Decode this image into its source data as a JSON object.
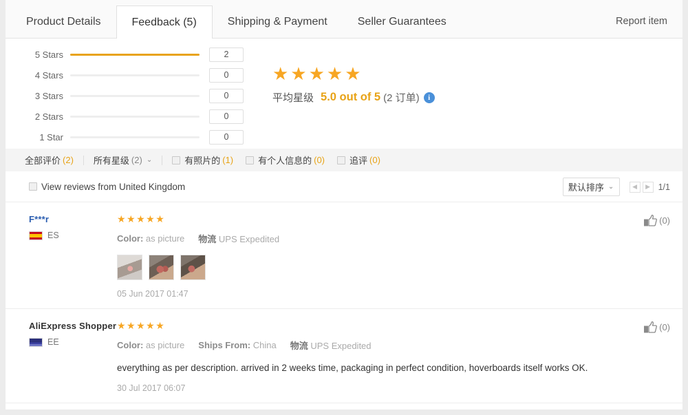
{
  "tabs": [
    {
      "label": "Product Details",
      "active": false
    },
    {
      "label": "Feedback (5)",
      "active": true
    },
    {
      "label": "Shipping & Payment",
      "active": false
    },
    {
      "label": "Seller Guarantees",
      "active": false
    }
  ],
  "report_item": "Report item",
  "rating_breakdown": [
    {
      "label": "5 Stars",
      "count": "2",
      "percent": 100
    },
    {
      "label": "4 Stars",
      "count": "0",
      "percent": 0
    },
    {
      "label": "3 Stars",
      "count": "0",
      "percent": 0
    },
    {
      "label": "2 Stars",
      "count": "0",
      "percent": 0
    },
    {
      "label": "1 Star",
      "count": "0",
      "percent": 0
    }
  ],
  "average": {
    "stars_filled": 5,
    "label": "平均星级",
    "score": "5.0 out of 5",
    "orders": "(2 订单)",
    "info_icon": "info-icon",
    "info_glyph": "i"
  },
  "filters": {
    "all_reviews": "全部评价",
    "all_reviews_count": "(2)",
    "all_stars": "所有星级",
    "all_stars_count": "(2)",
    "caret": "⌄",
    "with_photos": "有照片的",
    "with_photos_count": "(1)",
    "with_personal_info": "有个人信息的",
    "with_personal_info_count": "(0)",
    "additional": "追评",
    "additional_count": "(0)"
  },
  "sort_row": {
    "view_reviews_label": "View reviews from United Kingdom",
    "sort_label": "默认排序",
    "sort_caret": "⌄",
    "prev_arrow": "◀",
    "next_arrow": "▶",
    "page_info": "1/1"
  },
  "reviews": [
    {
      "username": "F***r",
      "username_is_link": true,
      "country_code": "ES",
      "flag": "flag-es",
      "stars": 5,
      "attrs": [
        {
          "key": "Color:",
          "value": "as picture",
          "key_cn": false
        },
        {
          "key": "物流",
          "value": "UPS Expedited",
          "key_cn": true
        }
      ],
      "photos": [
        "review-photo-1",
        "review-photo-2",
        "review-photo-3"
      ],
      "text": "",
      "date": "05 Jun 2017 01:47",
      "helpful_count": "(0)",
      "helpful_icon": "thumbs-up-icon"
    },
    {
      "username": "AliExpress Shopper",
      "username_is_link": false,
      "country_code": "EE",
      "flag": "flag-ee",
      "stars": 5,
      "attrs": [
        {
          "key": "Color:",
          "value": "as picture",
          "key_cn": false
        },
        {
          "key": "Ships From:",
          "value": "China",
          "key_cn": false
        },
        {
          "key": "物流",
          "value": "UPS Expedited",
          "key_cn": true
        }
      ],
      "photos": [],
      "text": "everything as per description. arrived in 2 weeks time, packaging in perfect condition, hoverboards itself works OK.",
      "date": "30 Jul 2017 06:07",
      "helpful_count": "(0)",
      "helpful_icon": "thumbs-up-icon"
    }
  ],
  "colors": {
    "accent_orange": "#e8a317",
    "star_gold": "#f7a623",
    "link_blue": "#2a5db0",
    "info_blue": "#4a90d9",
    "page_bg": "#ececec",
    "filter_bg": "#f4f4f4"
  },
  "glyphs": {
    "star": "★"
  }
}
